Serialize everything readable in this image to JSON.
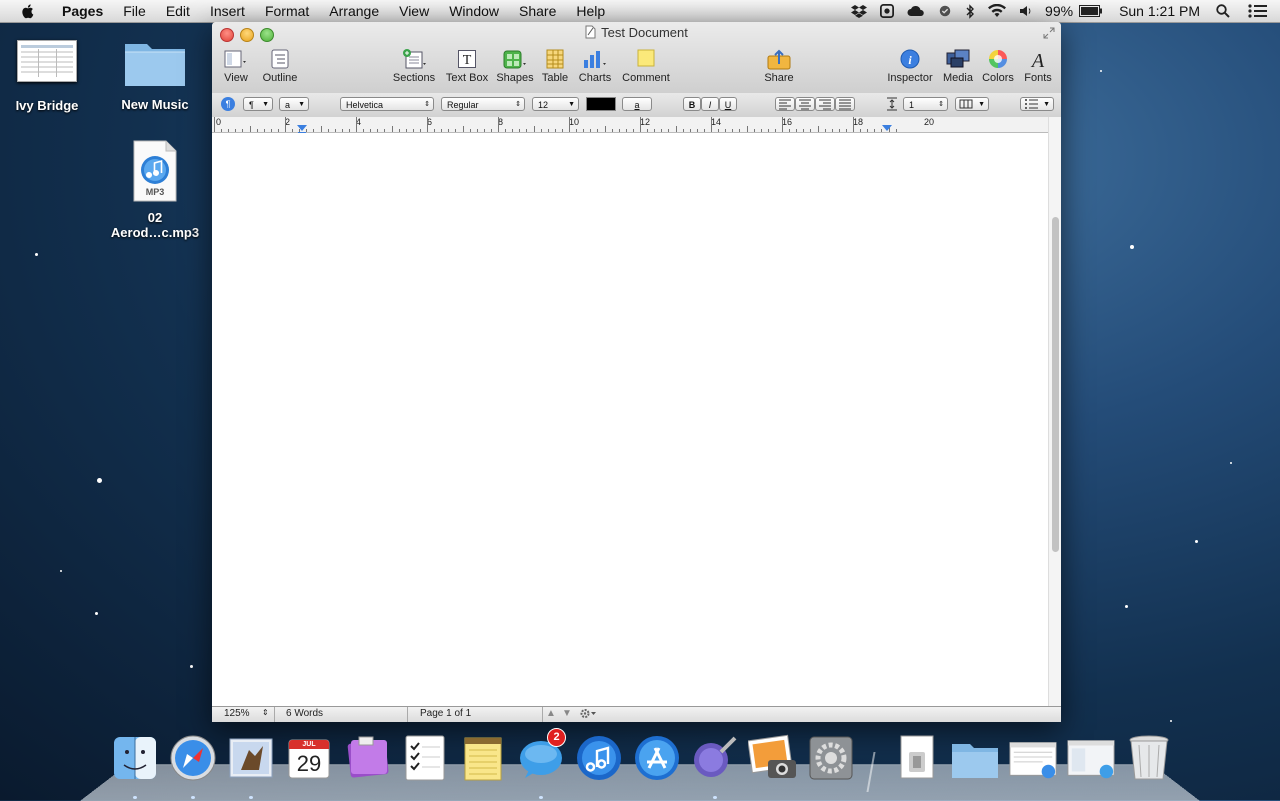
{
  "menubar": {
    "app": "Pages",
    "items": [
      "File",
      "Edit",
      "Insert",
      "Format",
      "Arrange",
      "View",
      "Window",
      "Share",
      "Help"
    ],
    "battery": "99%",
    "clock": "Sun 1:21 PM"
  },
  "desktop": {
    "icons": [
      {
        "label": "Ivy Bridge"
      },
      {
        "label": "New Music"
      },
      {
        "label_line1": "02",
        "label_line2": "Aerod…c.mp3",
        "badge": "MP3"
      }
    ]
  },
  "window": {
    "title": "Test Document",
    "toolbar": {
      "view": "View",
      "outline": "Outline",
      "sections": "Sections",
      "textbox": "Text Box",
      "shapes": "Shapes",
      "table": "Table",
      "charts": "Charts",
      "comment": "Comment",
      "share": "Share",
      "inspector": "Inspector",
      "media": "Media",
      "colors": "Colors",
      "fonts": "Fonts"
    },
    "format": {
      "paragraph_style": "¶",
      "char_style": "a",
      "font": "Helvetica",
      "typeface": "Regular",
      "size": "12",
      "highlight_glyph": "a",
      "bold": "B",
      "italic": "I",
      "underline": "U",
      "line_spacing": "1"
    },
    "ruler": [
      "0",
      "2",
      "4",
      "6",
      "8",
      "10",
      "12",
      "14",
      "16",
      "18",
      "20"
    ],
    "status": {
      "zoom": "125%",
      "words": "6 Words",
      "page": "Page 1 of 1"
    }
  },
  "dock": {
    "apps": [
      "Finder",
      "Safari",
      "Mail",
      "Calendar",
      "Notebook",
      "Reminders",
      "Notes",
      "Messages",
      "iTunes",
      "App Store",
      "Preview",
      "iPhoto",
      "System Preferences",
      "Documents",
      "Downloads",
      "Screenshot",
      "Messages Window",
      "Trash"
    ],
    "calendar_month": "JUL",
    "calendar_day": "29",
    "messages_badge": "2"
  },
  "colors": {
    "accent": "#3b7fe0",
    "close": "#ee5d52",
    "min": "#f5be3a",
    "max": "#5dc73f"
  }
}
